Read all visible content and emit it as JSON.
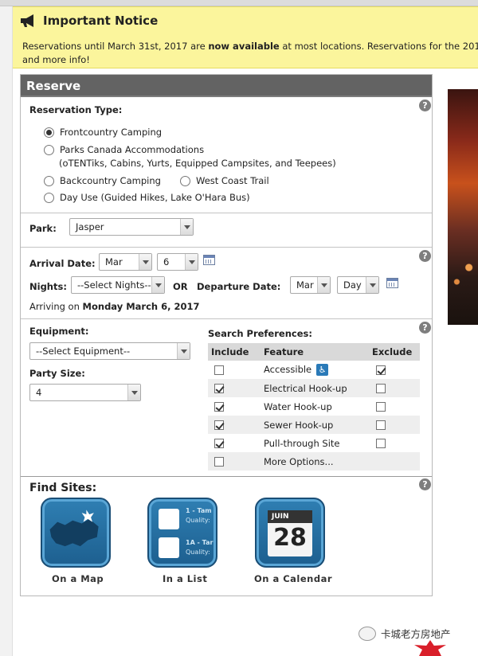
{
  "notice": {
    "title": "Important Notice",
    "line1_a": "Reservations until March 31st, 2017 are ",
    "line1_b": "now available",
    "line1_c": " at most locations. Reservations for the 201",
    "line2": "and more info!"
  },
  "reserve": {
    "title": "Reserve",
    "help_symbol": "?",
    "reservation_type": {
      "label": "Reservation Type:",
      "options": [
        {
          "label": "Frontcountry Camping",
          "selected": true
        },
        {
          "label": "Parks Canada Accommodations",
          "selected": false
        },
        {
          "label": "Backcountry Camping",
          "selected": false
        },
        {
          "label": "West Coast Trail",
          "selected": false
        },
        {
          "label": "Day Use (Guided Hikes, Lake O'Hara Bus)",
          "selected": false
        }
      ],
      "accommodations_note": "(oTENTiks, Cabins, Yurts, Equipped Campsites, and Teepees)"
    },
    "park": {
      "label": "Park:",
      "value": "Jasper"
    },
    "dates": {
      "arrival_label": "Arrival Date:",
      "arrival_month": "Mar",
      "arrival_day": "6",
      "nights_label": "Nights:",
      "nights_value": "--Select Nights--",
      "or_label": "OR",
      "departure_label": "Departure Date:",
      "departure_month": "Mar",
      "departure_day": "Day",
      "arriving_prefix": "Arriving on ",
      "arriving_date": "Monday March 6, 2017"
    },
    "equipment": {
      "label": "Equipment:",
      "value": "--Select Equipment--"
    },
    "party": {
      "label": "Party Size:",
      "value": "4"
    },
    "preferences": {
      "label": "Search Preferences:",
      "headers": {
        "include": "Include",
        "feature": "Feature",
        "exclude": "Exclude"
      },
      "rows": [
        {
          "feature": "Accessible",
          "include": false,
          "exclude": true
        },
        {
          "feature": "Electrical Hook-up",
          "include": true,
          "exclude": false
        },
        {
          "feature": "Water Hook-up",
          "include": true,
          "exclude": false
        },
        {
          "feature": "Sewer Hook-up",
          "include": true,
          "exclude": false
        },
        {
          "feature": "Pull-through Site",
          "include": true,
          "exclude": false
        },
        {
          "feature": "More Options...",
          "include": false,
          "exclude": null
        }
      ]
    },
    "find_sites": {
      "label": "Find Sites:",
      "map_label": "On a Map",
      "list_label": "In a List",
      "calendar_label": "On a Calendar",
      "calendar_month": "JUIN",
      "calendar_day": "28",
      "list_item_1": "1 - Tam",
      "list_item_1_sub": "Quality:",
      "list_item_2": "1A - Tar",
      "list_item_2_sub": "Quality:"
    }
  },
  "watermark": {
    "text": "卡城老方房地产"
  },
  "colors": {
    "notice_bg": "#fbf59c",
    "header_bg": "#636363",
    "tile_blue": "#2f7fb3"
  }
}
